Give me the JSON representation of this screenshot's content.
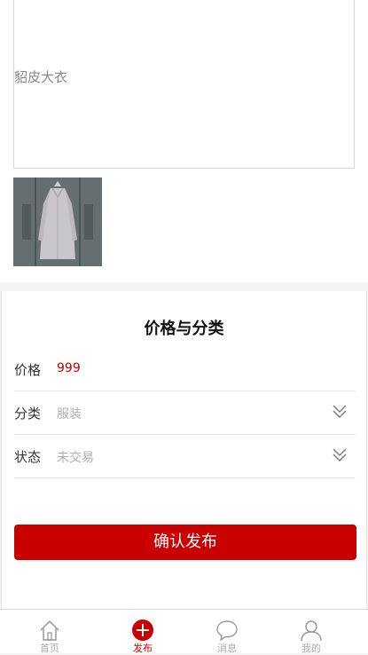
{
  "description": {
    "text": "貂皮大衣"
  },
  "photo": {
    "alt": "coat"
  },
  "section": {
    "title": "价格与分类"
  },
  "fields": {
    "price": {
      "label": "价格",
      "value": "999"
    },
    "category": {
      "label": "分类",
      "value": "服装"
    },
    "status": {
      "label": "状态",
      "value": "未交易"
    }
  },
  "confirm": {
    "label": "确认发布"
  },
  "tabbar": {
    "home": "首页",
    "publish": "发布",
    "messages": "消息",
    "mine": "我的"
  },
  "colors": {
    "accent": "#c90000",
    "muted": "#aaaaaa"
  }
}
